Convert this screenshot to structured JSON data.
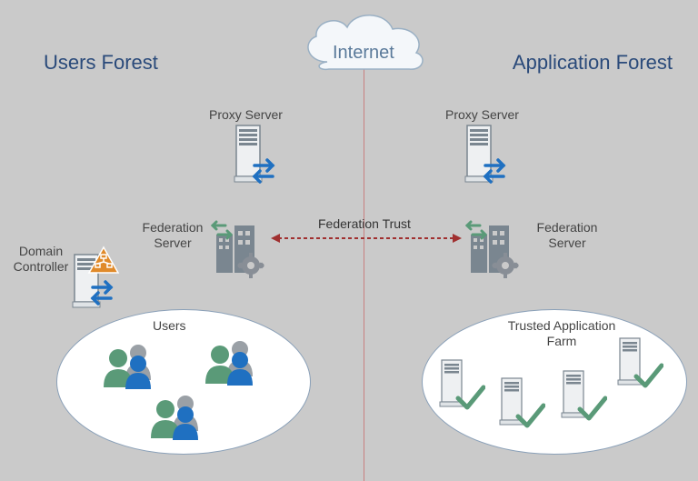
{
  "titles": {
    "left": "Users Forest",
    "right": "Application Forest",
    "internet": "Internet"
  },
  "labels": {
    "proxy_left": "Proxy Server",
    "proxy_right": "Proxy Server",
    "fed_left": "Federation Server",
    "fed_right": "Federation Server",
    "dc": "Domain Controller",
    "users": "Users",
    "farm": "Trusted Application Farm",
    "trust": "Federation Trust"
  },
  "colors": {
    "blue": "#1f70c1",
    "green": "#5a9a78",
    "grey": "#7a8690",
    "dark": "#555a60",
    "orange": "#e08a2a",
    "red": "#a03030",
    "title": "#2a4a7a"
  }
}
